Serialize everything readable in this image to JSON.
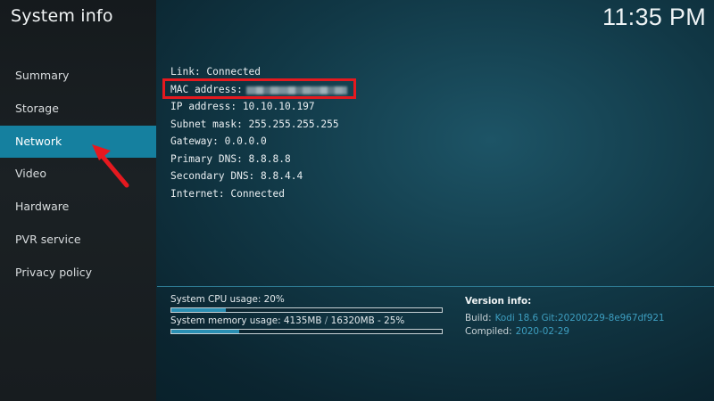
{
  "sidebar": {
    "title": "System info",
    "items": [
      {
        "label": "Summary"
      },
      {
        "label": "Storage"
      },
      {
        "label": "Network",
        "active": true
      },
      {
        "label": "Video"
      },
      {
        "label": "Hardware"
      },
      {
        "label": "PVR service"
      },
      {
        "label": "Privacy policy"
      }
    ]
  },
  "header": {
    "clock": "11:35 PM"
  },
  "network_info": {
    "link": "Link: Connected",
    "mac_label": "MAC address:",
    "ip": "IP address: 10.10.10.197",
    "subnet": "Subnet mask: 255.255.255.255",
    "gateway": "Gateway: 0.0.0.0",
    "primary_dns": "Primary DNS: 8.8.8.8",
    "secondary_dns": "Secondary DNS: 8.8.4.4",
    "internet": "Internet: Connected"
  },
  "usage": {
    "cpu_label": "System CPU usage: 20%",
    "cpu_fraction": 0.2,
    "memory_label_used": "System memory usage: 4135MB",
    "memory_label_sep": "/",
    "memory_label_total": "16320MB - 25%",
    "memory_fraction": 0.25
  },
  "version": {
    "title": "Version info:",
    "build_label": "Build:",
    "build_value": "Kodi 18.6 Git:20200229-8e967df921",
    "compiled_label": "Compiled:",
    "compiled_value": "2020-02-29"
  },
  "colors": {
    "accent": "#15809f",
    "highlight": "#e5191f",
    "value_text": "#3d9ec0"
  },
  "icons": {
    "annotation_arrow": "red-arrow-icon"
  }
}
